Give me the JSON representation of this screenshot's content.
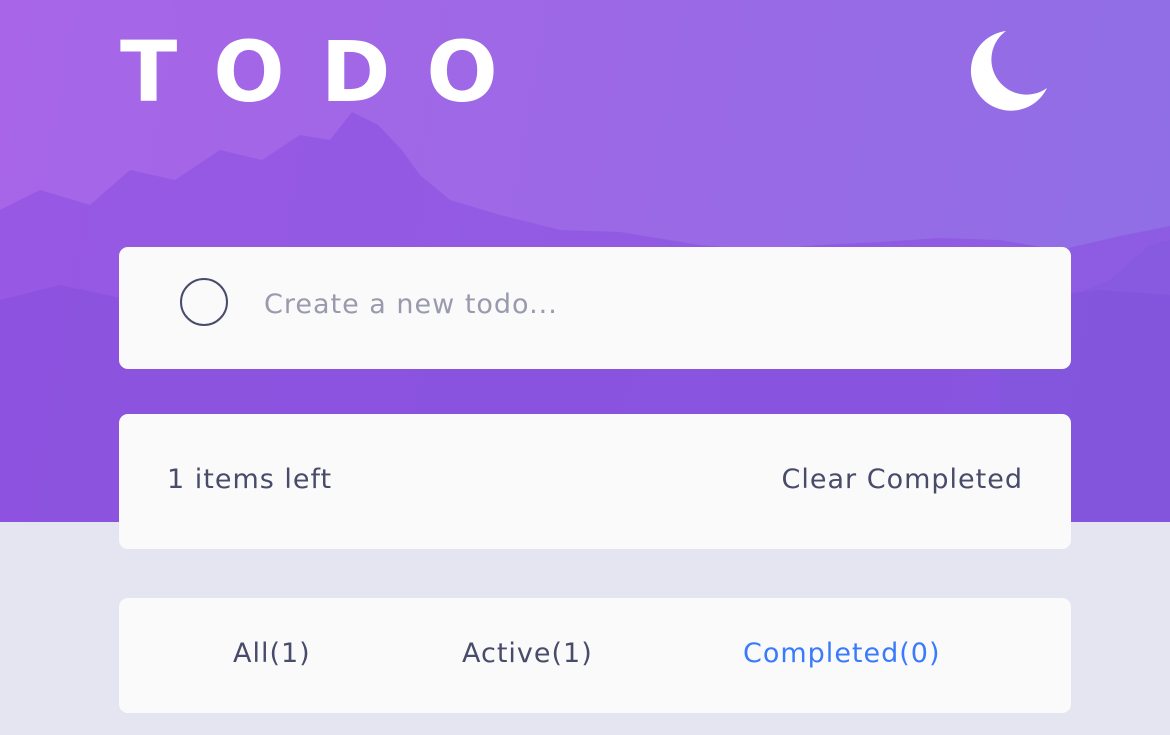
{
  "app": {
    "title": "TODO",
    "theme_toggle_icon": "moon-icon"
  },
  "new_todo": {
    "placeholder": "Create a new todo...",
    "value": "",
    "check_icon": "circle-icon"
  },
  "status": {
    "items_left": "1 items left",
    "clear_label": "Clear Completed"
  },
  "filters": {
    "all_label": "All(1)",
    "active_label": "Active(1)",
    "completed_label": "Completed(0)",
    "selected": "Completed(0)"
  },
  "colors": {
    "hero_start": "#a865e8",
    "hero_end": "#8f6fe6",
    "page_background": "#e4e5f1",
    "card_background": "#fafafa",
    "text": "#484b6a",
    "placeholder": "#9a9aae",
    "accent": "#3a7bfd"
  }
}
